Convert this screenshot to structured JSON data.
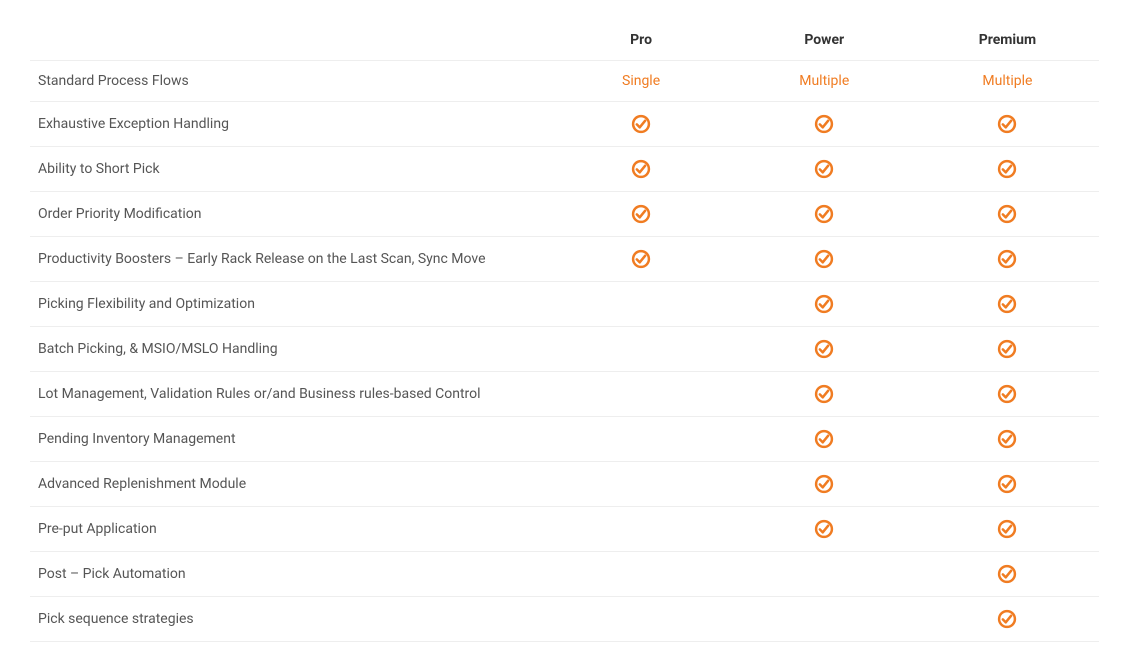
{
  "colors": {
    "accent": "#f07c22"
  },
  "table": {
    "plans": [
      "Pro",
      "Power",
      "Premium"
    ],
    "rows": [
      {
        "feature": "Standard Process Flows",
        "cells": [
          {
            "type": "text",
            "value": "Single"
          },
          {
            "type": "text",
            "value": "Multiple"
          },
          {
            "type": "text",
            "value": "Multiple"
          }
        ]
      },
      {
        "feature": "Exhaustive Exception Handling",
        "cells": [
          {
            "type": "check"
          },
          {
            "type": "check"
          },
          {
            "type": "check"
          }
        ]
      },
      {
        "feature": "Ability to Short Pick",
        "cells": [
          {
            "type": "check"
          },
          {
            "type": "check"
          },
          {
            "type": "check"
          }
        ]
      },
      {
        "feature": "Order Priority Modification",
        "cells": [
          {
            "type": "check"
          },
          {
            "type": "check"
          },
          {
            "type": "check"
          }
        ]
      },
      {
        "feature": "Productivity Boosters – Early Rack Release on the Last Scan, Sync Move",
        "cells": [
          {
            "type": "check"
          },
          {
            "type": "check"
          },
          {
            "type": "check"
          }
        ]
      },
      {
        "feature": "Picking Flexibility and Optimization",
        "cells": [
          {
            "type": "empty"
          },
          {
            "type": "check"
          },
          {
            "type": "check"
          }
        ]
      },
      {
        "feature": "Batch Picking, & MSIO/MSLO Handling",
        "cells": [
          {
            "type": "empty"
          },
          {
            "type": "check"
          },
          {
            "type": "check"
          }
        ]
      },
      {
        "feature": "Lot Management, Validation Rules or/and Business rules-based Control",
        "cells": [
          {
            "type": "empty"
          },
          {
            "type": "check"
          },
          {
            "type": "check"
          }
        ]
      },
      {
        "feature": "Pending Inventory Management",
        "cells": [
          {
            "type": "empty"
          },
          {
            "type": "check"
          },
          {
            "type": "check"
          }
        ]
      },
      {
        "feature": "Advanced Replenishment Module",
        "cells": [
          {
            "type": "empty"
          },
          {
            "type": "check"
          },
          {
            "type": "check"
          }
        ]
      },
      {
        "feature": "Pre-put Application",
        "cells": [
          {
            "type": "empty"
          },
          {
            "type": "check"
          },
          {
            "type": "check"
          }
        ]
      },
      {
        "feature": "Post – Pick Automation",
        "cells": [
          {
            "type": "empty"
          },
          {
            "type": "empty"
          },
          {
            "type": "check"
          }
        ]
      },
      {
        "feature": "Pick sequence strategies",
        "cells": [
          {
            "type": "empty"
          },
          {
            "type": "empty"
          },
          {
            "type": "check"
          }
        ]
      }
    ]
  }
}
